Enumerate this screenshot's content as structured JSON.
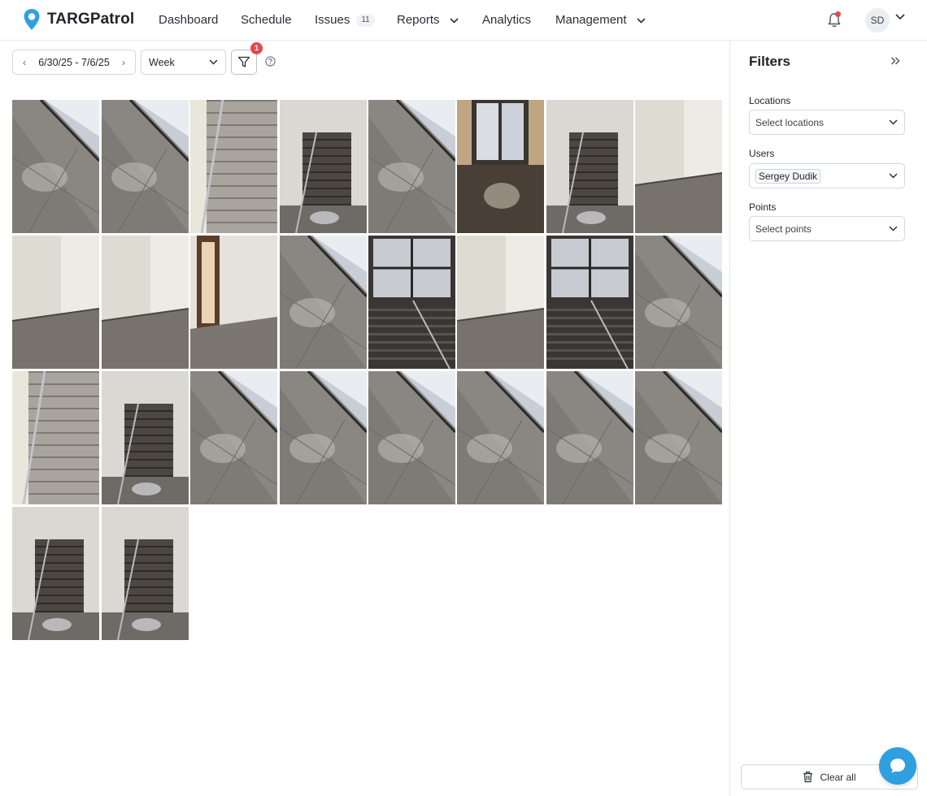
{
  "app": {
    "brand": "TARGPatrol",
    "brand_color": "#2ea0e0"
  },
  "nav": {
    "dashboard": "Dashboard",
    "schedule": "Schedule",
    "issues": "Issues",
    "issues_count": "11",
    "reports": "Reports",
    "analytics": "Analytics",
    "management": "Management"
  },
  "user": {
    "initials": "SD",
    "has_notification": true
  },
  "toolbar": {
    "date_range": "6/30/25 - 7/6/25",
    "period": "Week",
    "active_filters": "1"
  },
  "photos": [
    {
      "scene": "floor-window"
    },
    {
      "scene": "floor-window"
    },
    {
      "scene": "stairs-up-light"
    },
    {
      "scene": "stairs-dark"
    },
    {
      "scene": "floor-window"
    },
    {
      "scene": "door-window"
    },
    {
      "scene": "stairs-dark"
    },
    {
      "scene": "hall-light"
    },
    {
      "scene": "hall-light"
    },
    {
      "scene": "hall-light"
    },
    {
      "scene": "doorway"
    },
    {
      "scene": "floor-window"
    },
    {
      "scene": "window-stairs"
    },
    {
      "scene": "hall-light"
    },
    {
      "scene": "window-stairs"
    },
    {
      "scene": "floor-window"
    },
    {
      "scene": "stairs-up-light"
    },
    {
      "scene": "stairs-dark"
    },
    {
      "scene": "floor-window"
    },
    {
      "scene": "floor-window"
    },
    {
      "scene": "floor-window"
    },
    {
      "scene": "floor-window"
    },
    {
      "scene": "floor-window"
    },
    {
      "scene": "floor-window"
    },
    {
      "scene": "stairs-dark"
    },
    {
      "scene": "stairs-dark"
    }
  ],
  "filters": {
    "title": "Filters",
    "locations": {
      "label": "Locations",
      "placeholder": "Select locations"
    },
    "users": {
      "label": "Users",
      "selected": "Sergey Dudik"
    },
    "points": {
      "label": "Points",
      "placeholder": "Select points"
    },
    "clear_all": "Clear all"
  }
}
